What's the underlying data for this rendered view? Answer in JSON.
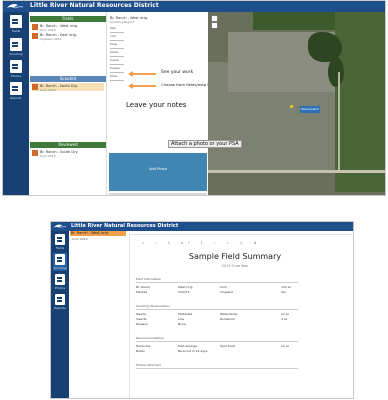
{
  "screenshot_1": {
    "header_title": "Little River Natural Resources District",
    "nav": [
      {
        "icon": "fields-icon",
        "label": "Fields"
      },
      {
        "icon": "document-icon",
        "label": "Scouting"
      },
      {
        "icon": "document-icon",
        "label": "Photos"
      },
      {
        "icon": "document-icon",
        "label": "Reports"
      }
    ],
    "list_headers": [
      "Fields",
      "Scouted",
      "Reviewed"
    ],
    "list_rows": [
      {
        "title": "Br. Ranch - West Irrig.",
        "sub": "Corn 2015"
      },
      {
        "title": "Br. Ranch - East Irrig.",
        "sub": "Soybean 2015"
      },
      {
        "title": "Br. Ranch - North Dry.",
        "sub": "Corn 2015"
      },
      {
        "title": "Br. Ranch - South Dry.",
        "sub": "Corn 2015"
      }
    ],
    "form_header": "Br. Ranch - West Irrig.",
    "form_subheader": "Scouting Report",
    "fields": [
      "Date",
      "Crop",
      "Stage",
      "Weeds",
      "Insects",
      "Disease",
      "Notes"
    ],
    "callouts": {
      "see_work": "See your work",
      "choose_field": "Choose from fields/map the problem area",
      "leave_notes": "Leave your notes",
      "attach_photo": "Attach a photo or your PSA"
    },
    "photo_area_label": "Add Photo",
    "map_pin_label": "Weed patch"
  },
  "screenshot_2": {
    "header_title": "Little River Natural Resources District",
    "nav": [
      {
        "icon": "fields-icon",
        "label": "Fields"
      },
      {
        "icon": "document-icon",
        "label": "Scouting",
        "active": true
      },
      {
        "icon": "document-icon",
        "label": "Photos"
      },
      {
        "icon": "document-icon",
        "label": "Reports"
      }
    ],
    "selected_item": "Br. Ranch - West Irrig.",
    "selected_sub": "Corn 2015",
    "toolbar": "« ‹ 1 of 1 › » ⎙ ⬇",
    "report_title": "Sample Field Summary",
    "report_subtitle": "2015 Crop Year",
    "sections": [
      {
        "heading": "Field Information",
        "rows": [
          [
            "Br. Ranch",
            "West Irrig.",
            "Corn",
            "132 ac"
          ],
          [
            "Planted",
            "5/02/15",
            "Irrigated",
            "Yes"
          ]
        ]
      },
      {
        "heading": "Scouting Observations",
        "rows": [
          [
            "Weeds",
            "Moderate",
            "Waterhemp",
            "12 ac"
          ],
          [
            "Insects",
            "Low",
            "Rootworm",
            "4 ac"
          ],
          [
            "Disease",
            "None",
            "",
            ""
          ]
        ]
      },
      {
        "heading": "Recommendations",
        "rows": [
          [
            "Herbicide",
            "Post-emerge",
            "Spot treat",
            "12 ac"
          ],
          [
            "Notes",
            "Re-scout in 14 days",
            "",
            ""
          ]
        ]
      },
      {
        "heading": "Photos Attached",
        "rows": []
      }
    ]
  }
}
